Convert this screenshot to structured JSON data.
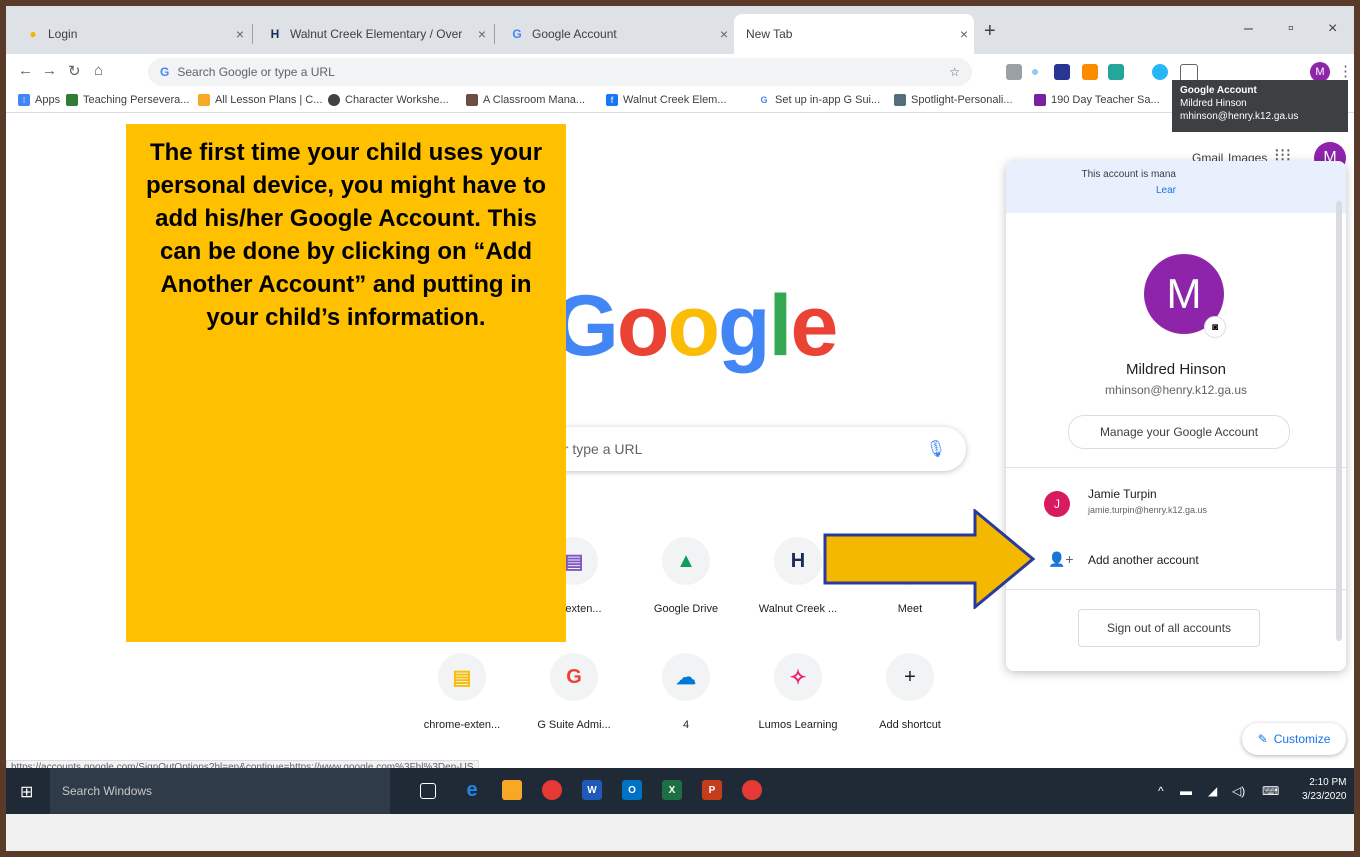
{
  "tabs": [
    {
      "title": "Login",
      "icon": "login-icon"
    },
    {
      "title": "Walnut Creek Elementary / Over",
      "icon": "walnut-creek-icon"
    },
    {
      "title": "Google Account",
      "icon": "google-icon"
    },
    {
      "title": "New Tab",
      "active": true
    }
  ],
  "omnibox": {
    "placeholder": "Search Google or type a URL"
  },
  "bookmarks": [
    {
      "label": "Apps",
      "color": "#4285f4"
    },
    {
      "label": "Teaching Persevera...",
      "color": "#2e7d32"
    },
    {
      "label": "All Lesson Plans | C...",
      "color": "#f9a825"
    },
    {
      "label": "Character Workshe...",
      "color": "#424242"
    },
    {
      "label": "A Classroom Mana...",
      "color": "#6d4c41"
    },
    {
      "label": "Walnut Creek Elem...",
      "color": "#1877f2"
    },
    {
      "label": "Set up in-app G Sui...",
      "color": "#4285f4"
    },
    {
      "label": "Spotlight-Personali...",
      "color": "#546e7a"
    },
    {
      "label": "190 Day Teacher Sa...",
      "color": "#7b1fa2"
    }
  ],
  "page": {
    "gmail": "Gmail",
    "images": "Images",
    "avatar_letter": "M",
    "logo": "Google",
    "search_placeholder": "or type a URL",
    "customize": "Customize"
  },
  "shortcuts_row1": [
    {
      "label": "me-exten...",
      "glyph": "▤",
      "color": "#7e57c2"
    },
    {
      "label": "Google Drive",
      "glyph": "▲",
      "color": "#0f9d58"
    },
    {
      "label": "Walnut Creek ...",
      "glyph": "H",
      "color": "#1a2a5a"
    },
    {
      "label": "Meet",
      "glyph": "",
      "color": "#00897b"
    }
  ],
  "shortcuts_row2": [
    {
      "label": "chrome-exten...",
      "glyph": "▤",
      "color": "#fbbc04"
    },
    {
      "label": "G Suite Admi...",
      "glyph": "G",
      "color": "#ea4335"
    },
    {
      "label": "4",
      "glyph": "☁",
      "color": "#0078d4"
    },
    {
      "label": "Lumos Learning",
      "glyph": "✧",
      "color": "#e91e63"
    },
    {
      "label": "Add shortcut",
      "glyph": "+",
      "color": "#202124"
    }
  ],
  "popup": {
    "managed_text": "This account is mana",
    "managed_link": "Lear",
    "name": "Mildred Hinson",
    "email": "mhinson@henry.k12.ga.us",
    "avatar_letter": "M",
    "manage_button": "Manage your Google Account",
    "other_account": {
      "letter": "J",
      "name": "Jamie Turpin",
      "email": "jamie.turpin@henry.k12.ga.us"
    },
    "add_account": "Add another account",
    "sign_out": "Sign out of all accounts"
  },
  "tooltip": {
    "title": "Google Account",
    "name": "Mildred Hinson",
    "email": "mhinson@henry.k12.ga.us"
  },
  "status_url": "https://accounts.google.com/SignOutOptions?hl=en&continue=https://www.google.com%3Fhl%3Den-US",
  "taskbar": {
    "search": "Search Windows",
    "time": "2:10 PM",
    "date": "3/23/2020"
  },
  "callout": {
    "text": "The first time your child uses your personal device, you might have to add his/her Google Account. This can be done by clicking on “Add Another Account” and putting in your child’s information."
  },
  "colors": {
    "arrow": "#f5b800",
    "arrow_outline": "#2a3a9a",
    "callout": "#ffc000"
  }
}
